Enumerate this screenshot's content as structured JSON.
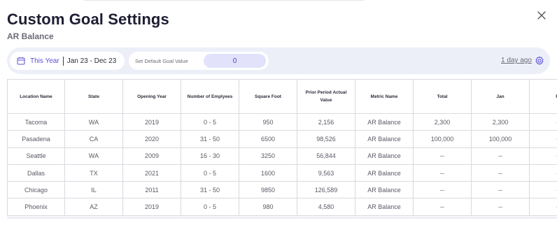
{
  "dialog": {
    "title": "Custom Goal Settings",
    "subtitle": "AR Balance"
  },
  "filters": {
    "period": "This Year",
    "date_range": "Jan 23 - Dec 23",
    "default_goal_label": "Set Default Goal Value",
    "default_goal_value": "0",
    "last_updated": "1 day ago"
  },
  "table": {
    "columns": [
      "Location Name",
      "State",
      "Opening Year",
      "Number of Emplyees",
      "Square Foot",
      "Prior Period Actual Value",
      "Metric Name",
      "Total",
      "Jan",
      "Fe"
    ],
    "rows": [
      [
        "Tacoma",
        "WA",
        "2019",
        "0 - 5",
        "950",
        "2,156",
        "AR Balance",
        "2,300",
        "2,300",
        "--"
      ],
      [
        "Pasadena",
        "CA",
        "2020",
        "31 - 50",
        "6500",
        "98,526",
        "AR Balance",
        "100,000",
        "100,000",
        "--"
      ],
      [
        "Seattle",
        "WA",
        "2009",
        "16 - 30",
        "3250",
        "56,844",
        "AR Balance",
        "--",
        "--",
        "--"
      ],
      [
        "Dallas",
        "TX",
        "2021",
        "0 - 5",
        "1600",
        "9,563",
        "AR Balance",
        "--",
        "--",
        "--"
      ],
      [
        "Chicago",
        "IL",
        "2011",
        "31 - 50",
        "9850",
        "126,589",
        "AR Balance",
        "--",
        "--",
        "--"
      ],
      [
        "Phoenix",
        "AZ",
        "2019",
        "0 - 5",
        "980",
        "4,580",
        "AR Balance",
        "--",
        "--",
        "--"
      ]
    ]
  },
  "colors": {
    "accent": "#5b4fd6",
    "filter_bar_bg": "#edeff8",
    "goal_input_bg": "#e3e2fb"
  },
  "icons": {
    "close": "close-icon",
    "calendar": "calendar-icon",
    "settings": "gear-icon"
  }
}
